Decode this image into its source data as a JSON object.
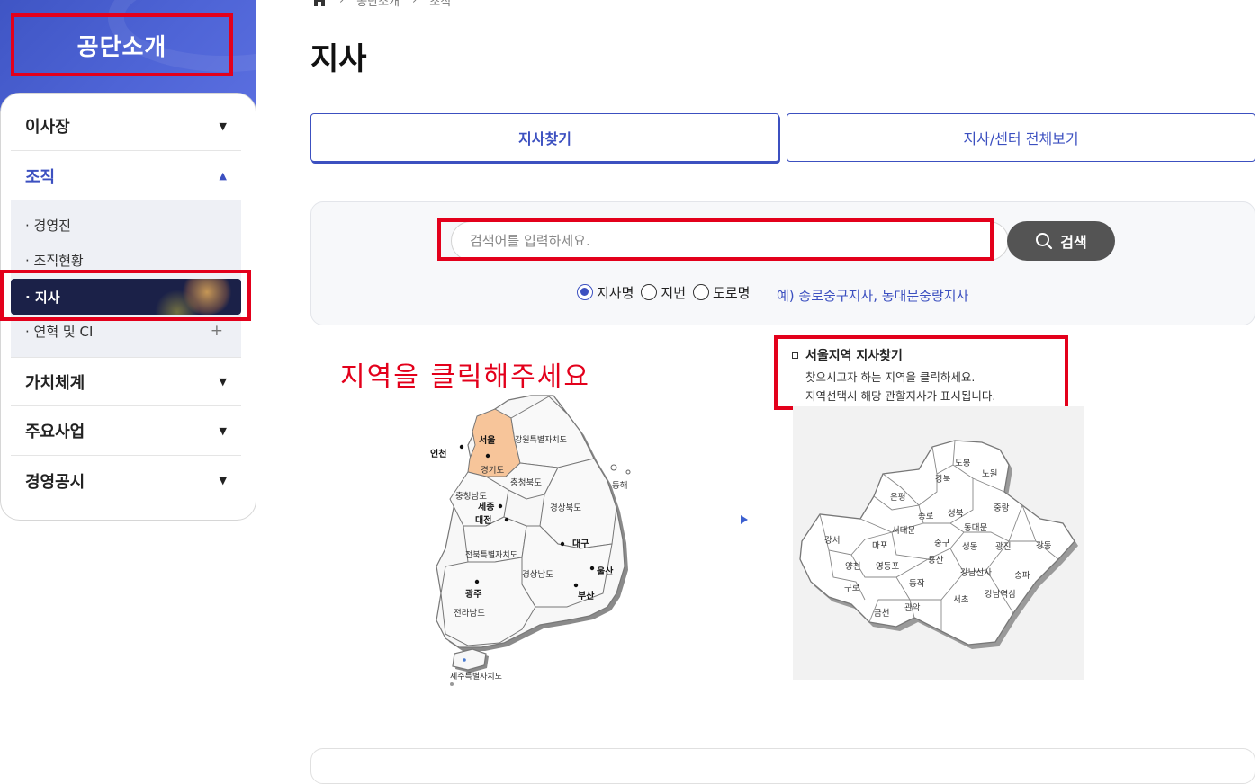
{
  "sidebar": {
    "title": "공단소개",
    "menu": [
      {
        "label": "이사장",
        "arrow": "▼"
      },
      {
        "label": "조직",
        "arrow": "▲"
      },
      {
        "label": "가치체계",
        "arrow": "▼"
      },
      {
        "label": "주요사업",
        "arrow": "▼"
      },
      {
        "label": "경영공시",
        "arrow": "▼"
      }
    ],
    "submenu": [
      {
        "label": "· 경영진"
      },
      {
        "label": "· 조직현황"
      },
      {
        "label": "· 지사"
      },
      {
        "label": "· 연혁 및 CI",
        "extra": "+"
      }
    ]
  },
  "breadcrumb": [
    "공단소개",
    "조직"
  ],
  "page": {
    "title": "지사"
  },
  "tabs": [
    {
      "label": "지사찾기"
    },
    {
      "label": "지사/센터 전체보기"
    }
  ],
  "search": {
    "placeholder": "검색어를 입력하세요.",
    "button_label": "검색",
    "options": [
      "지사명",
      "지번",
      "도로명"
    ],
    "example": "예) 종로중구지사, 동대문중랑지사"
  },
  "map": {
    "instruction": "지역을 클릭해주세요",
    "korea_regions": [
      "서울",
      "인천",
      "강원특별자치도",
      "경기도",
      "충청북도",
      "동해",
      "충청남도",
      "세종",
      "대전",
      "경상북도",
      "대구",
      "전북특별자치도",
      "울산",
      "경상남도",
      "광주",
      "부산",
      "전라남도",
      "제주특별자치도"
    ],
    "seoul_regions": [
      "도봉",
      "노원",
      "강북",
      "은평",
      "종로",
      "성북",
      "중랑",
      "서대문",
      "동대문",
      "강서",
      "마포",
      "중구",
      "성동",
      "광진",
      "강동",
      "양천",
      "영등포",
      "용산",
      "강남신사",
      "송파",
      "구로",
      "동작",
      "강남역삼",
      "금천",
      "관악",
      "서초"
    ]
  },
  "seoul_info": {
    "title": "서울지역 지사찾기",
    "line1": "찾으시고자 하는 지역을 클릭하세요.",
    "line2": "지역선택시 해당 관할지사가 표시됩니다."
  },
  "colors": {
    "accent": "#3c50c0",
    "highlight": "#e3001b",
    "seoul_fill": "#f7c59a"
  }
}
